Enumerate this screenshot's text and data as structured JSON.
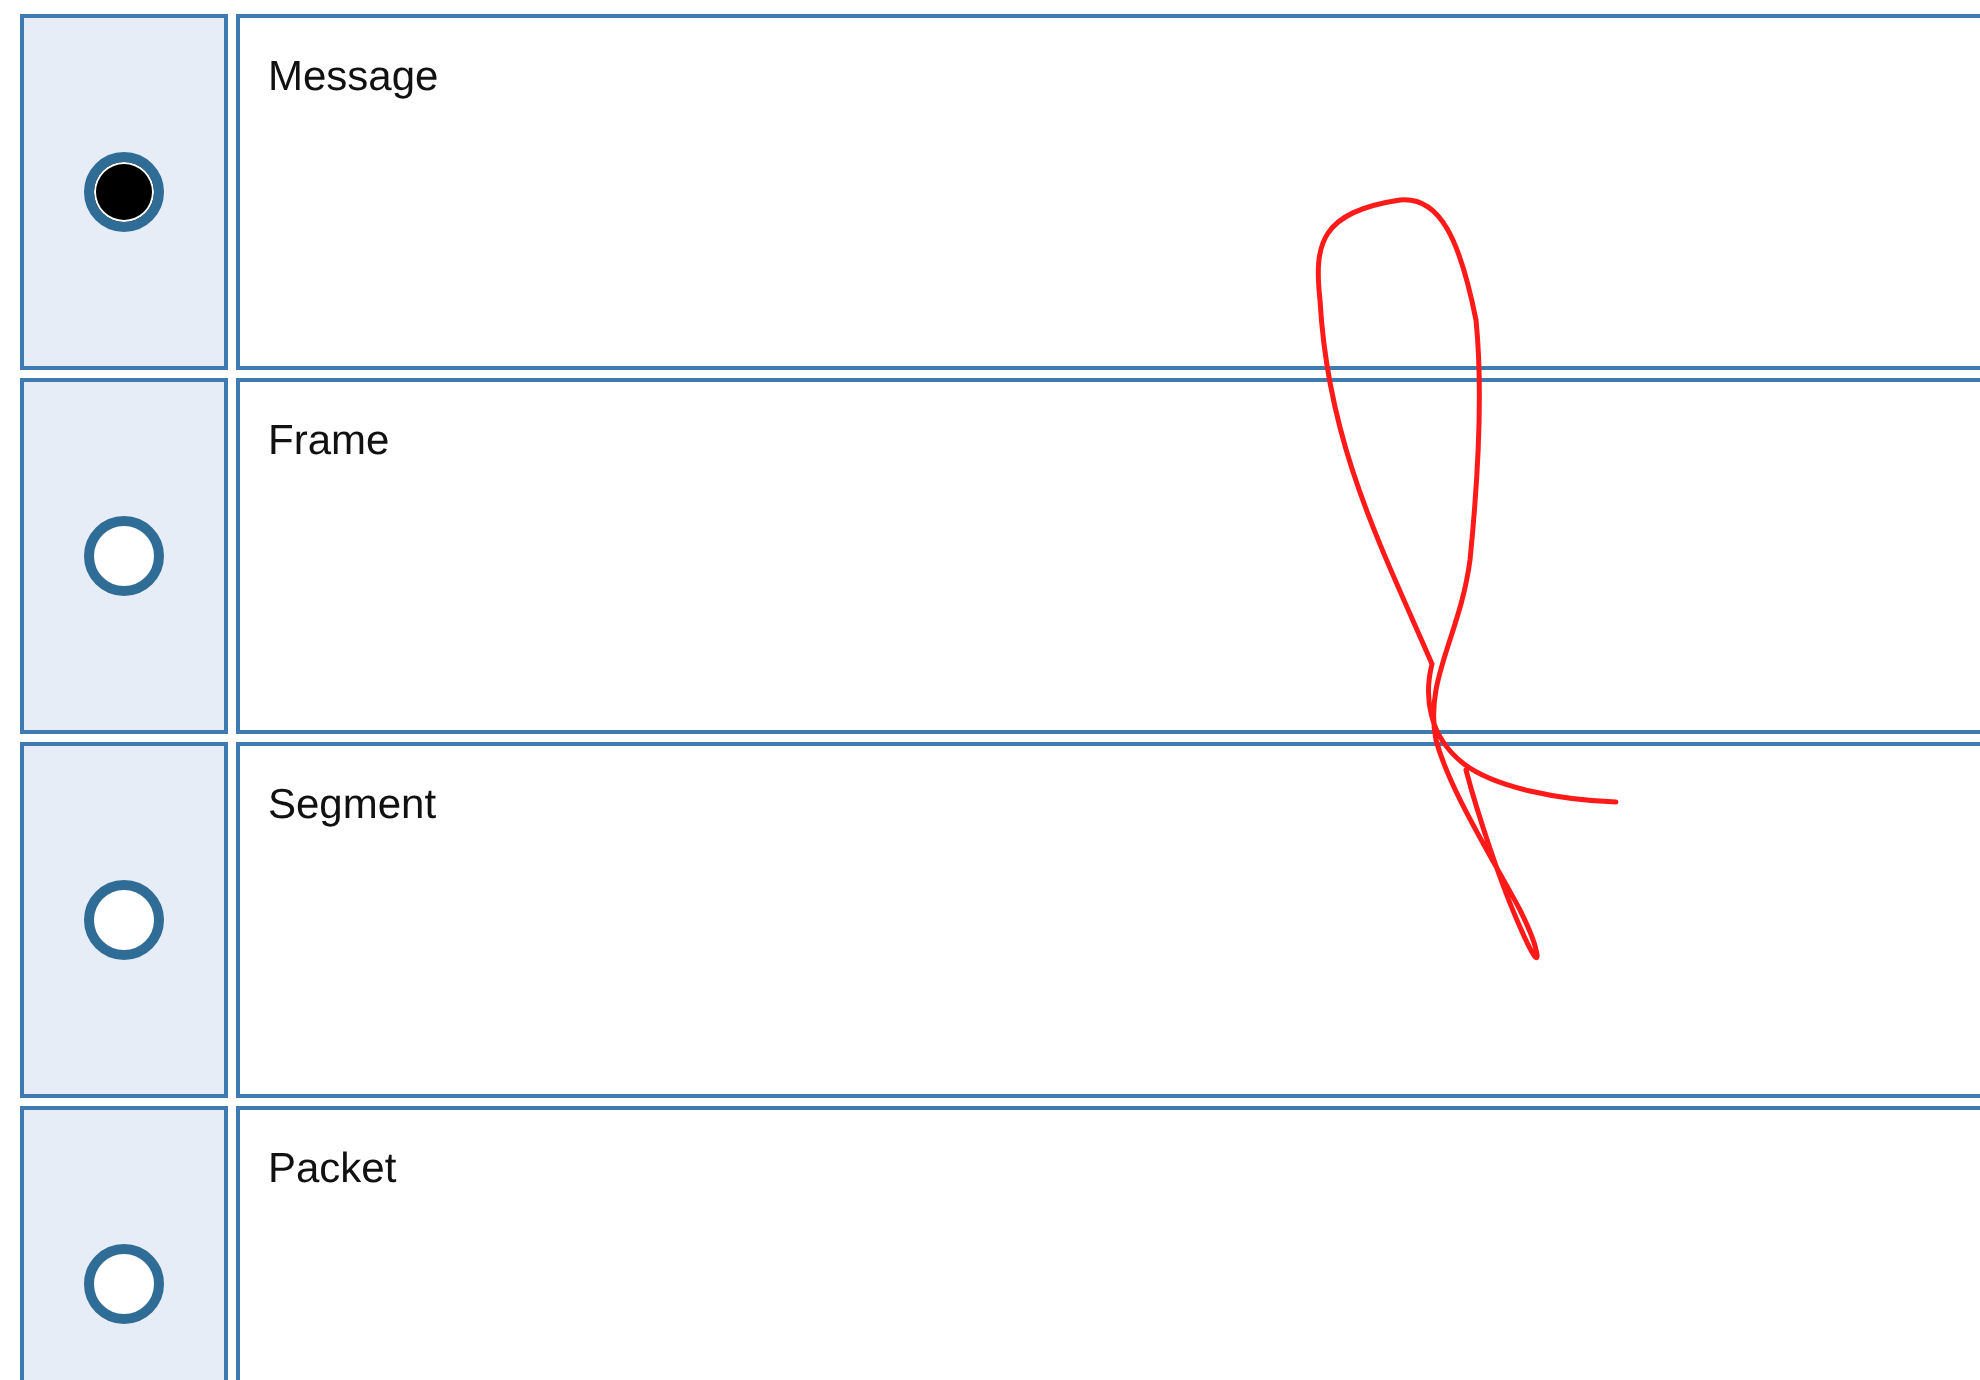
{
  "options": [
    {
      "label": "Message",
      "selected": true
    },
    {
      "label": "Frame",
      "selected": false
    },
    {
      "label": "Segment",
      "selected": false
    },
    {
      "label": "Packet",
      "selected": false
    }
  ]
}
